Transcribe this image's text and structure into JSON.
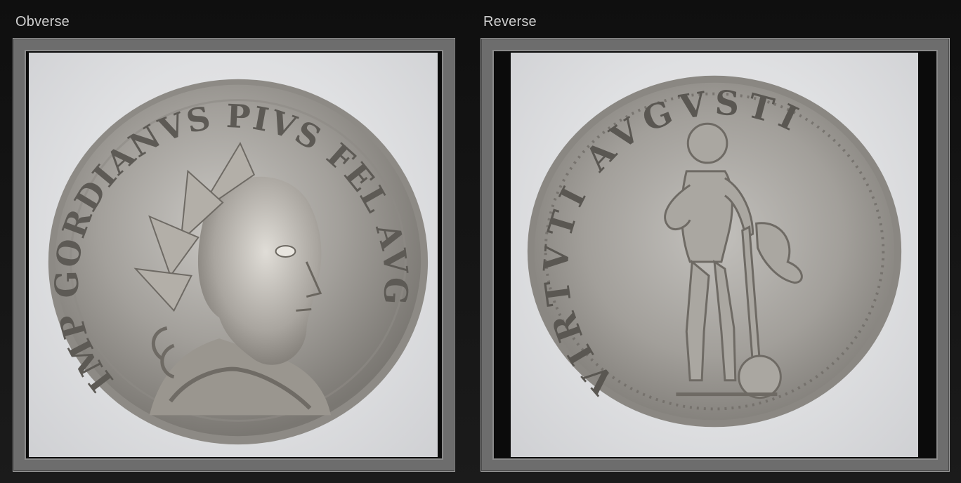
{
  "obverse": {
    "caption": "Obverse",
    "legend": "IMP GORDIANVS PIVS FEL AVG"
  },
  "reverse": {
    "caption": "Reverse",
    "legend": "VIRTVTI AVGVSTI"
  },
  "colors": {
    "background": "#141414",
    "frame": "#6d6d6d",
    "caption_text": "#cfcfcf",
    "photo_background": "#e0e1e3",
    "silver_coin": "#9c9a96"
  }
}
